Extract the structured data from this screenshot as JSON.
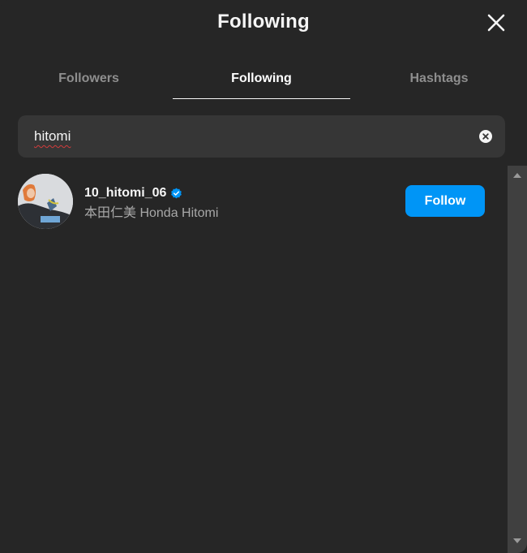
{
  "header": {
    "title": "Following",
    "close_icon": "close-icon"
  },
  "tabs": [
    {
      "label": "Followers",
      "active": false
    },
    {
      "label": "Following",
      "active": true
    },
    {
      "label": "Hashtags",
      "active": false
    }
  ],
  "search": {
    "value": "hitomi",
    "clear_icon": "clear-icon"
  },
  "results": [
    {
      "username": "10_hitomi_06",
      "verified": true,
      "full_name": "本田仁美 Honda Hitomi",
      "button_label": "Follow"
    }
  ],
  "colors": {
    "background": "#262626",
    "search_background": "#363636",
    "accent": "#0095f6",
    "muted_text": "#8e8e8e",
    "secondary_text": "#a8a8a8"
  }
}
